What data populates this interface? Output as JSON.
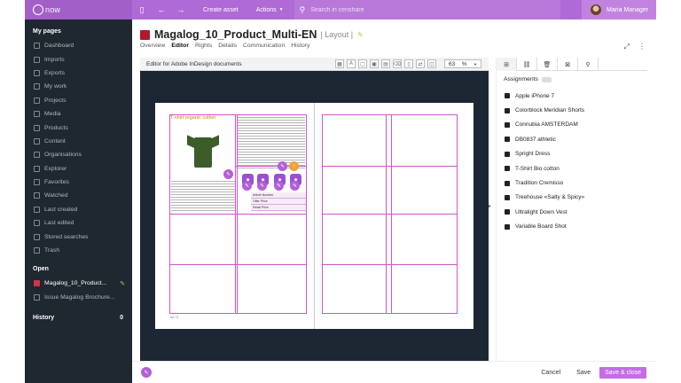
{
  "topbar": {
    "brand": "cenShare",
    "brand_visible": "now",
    "create_asset": "Create asset",
    "actions": "Actions",
    "search_placeholder": "Search in censhare",
    "user_name": "Maria Manager"
  },
  "sidebar": {
    "my_pages_title": "My pages",
    "items": [
      {
        "label": "Dashboard",
        "icon": "dashboard-icon"
      },
      {
        "label": "Imports",
        "icon": "import-icon"
      },
      {
        "label": "Exports",
        "icon": "export-icon"
      },
      {
        "label": "My work",
        "icon": "work-icon"
      },
      {
        "label": "Projects",
        "icon": "projects-icon"
      },
      {
        "label": "Media",
        "icon": "media-icon"
      },
      {
        "label": "Products",
        "icon": "products-icon"
      },
      {
        "label": "Content",
        "icon": "content-icon"
      },
      {
        "label": "Organisations",
        "icon": "organisations-icon"
      },
      {
        "label": "Explorer",
        "icon": "explorer-icon"
      },
      {
        "label": "Favorites",
        "icon": "favorites-icon"
      },
      {
        "label": "Watched",
        "icon": "watched-icon"
      },
      {
        "label": "Last created",
        "icon": "last-created-icon"
      },
      {
        "label": "Last edited",
        "icon": "last-edited-icon"
      },
      {
        "label": "Stored searches",
        "icon": "stored-searches-icon"
      },
      {
        "label": "Trash",
        "icon": "trash-icon"
      }
    ],
    "open_title": "Open",
    "open_items": [
      {
        "label": "Magalog_10_Product..."
      },
      {
        "label": "Issue Magalog Brochure..."
      }
    ],
    "history_title": "History",
    "history_count": "0"
  },
  "main": {
    "title": "Magalog_10_Product_Multi-EN",
    "subtitle": "| Layout |",
    "tabs": [
      "Overview",
      "Editor",
      "Rights",
      "Details",
      "Communication",
      "History"
    ],
    "active_tab": "Editor"
  },
  "editor": {
    "title": "Editor for Adobe InDesign documents",
    "zoom_value": "63",
    "zoom_unit": "%",
    "page_header": "T-shirt organic cotton",
    "price_rows": [
      "Article Number",
      "Offer Price",
      "Retail Price"
    ],
    "page_number": "12 / 3"
  },
  "panel": {
    "assignments_title": "Assignments",
    "assignments": [
      "Apple iPhone 7",
      "Colorblock Meridian Shorts",
      "Connubia AMSTERDAM",
      "DB0837 athletic",
      "Spright Dress",
      "T-Shirt Bio cotton",
      "Tradition Cremisso",
      "Treehouse «Salty & Spicy»",
      "Ultralight Down Vest",
      "Variable Board Shot"
    ]
  },
  "footer": {
    "cancel": "Cancel",
    "save": "Save",
    "save_close": "Save & close"
  },
  "colors": {
    "accent": "#b06ad6",
    "sidebar_bg": "#1f2730",
    "editor_bg": "#1c2733",
    "guide": "#cf55c8"
  }
}
